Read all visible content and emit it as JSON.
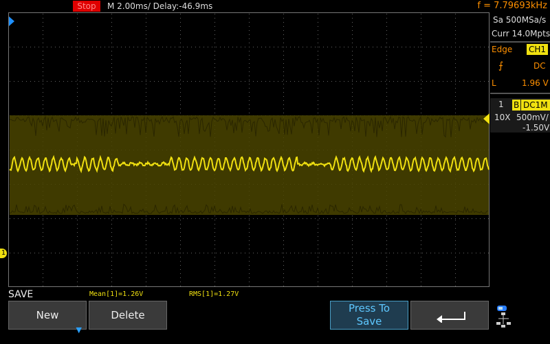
{
  "top_bar": {
    "status": "Stop",
    "timebase": "M 2.00ms/ Delay:-46.9ms",
    "frequency": "f = 7.79693kHz"
  },
  "right_panel": {
    "sample_rate": "Sa 500MSa/s",
    "memory": "Curr 14.0Mpts",
    "trigger_type": "Edge",
    "trigger_source": "CH1",
    "trigger_coupling": "DC",
    "trigger_level_label": "L",
    "trigger_level": "1.96 V",
    "ch_number": "1",
    "ch_bw": "B",
    "ch_coupling": "DC1M",
    "ch_probe": "10X",
    "ch_scale": "500mV/",
    "ch_offset": "-1.50V"
  },
  "markers": {
    "ch1_ground": "1"
  },
  "measurements": {
    "menu_title": "SAVE",
    "mean": "Mean[1]=1.26V",
    "rms": "RMS[1]=1.27V"
  },
  "softkeys": {
    "new": "New",
    "delete": "Delete",
    "press_to_save_line1": "Press To",
    "press_to_save_line2": "Save"
  },
  "colors": {
    "trace": "#f0e010",
    "stop": "#e00000",
    "accent": "#ff9000",
    "trigger": "#1e90ff"
  }
}
